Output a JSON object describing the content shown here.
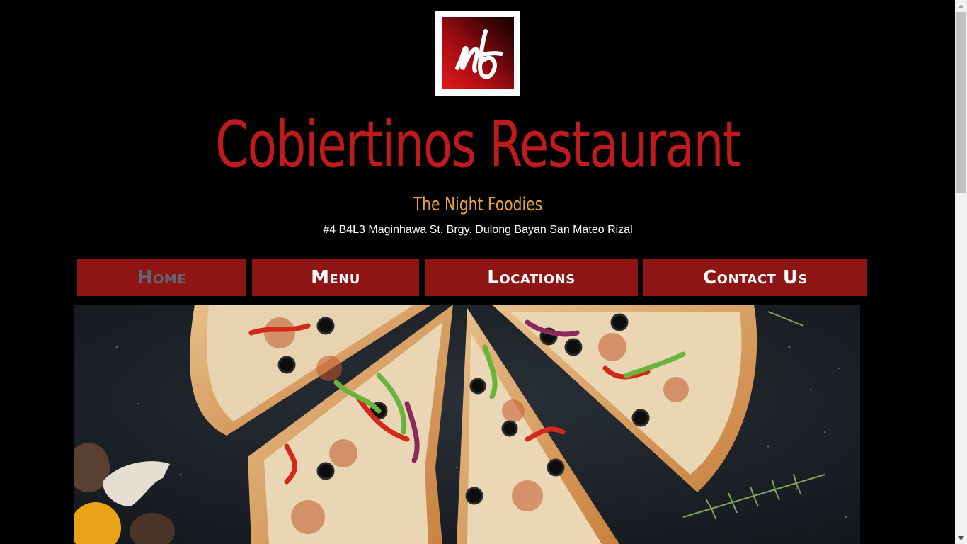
{
  "site": {
    "title": "Cobiertinos Restaurant",
    "tagline": "The Night Foodies",
    "address": "#4 B4L3 Maginhawa St. Brgy. Dulong Bayan San Mateo Rizal",
    "logo_letters": "nf"
  },
  "nav": {
    "items": [
      {
        "label": "Home",
        "active": true
      },
      {
        "label": "Menu",
        "active": false
      },
      {
        "label": "Locations",
        "active": false
      },
      {
        "label": "Contact Us",
        "active": false
      }
    ]
  },
  "hero": {
    "image": "pizza-slices-photo"
  },
  "colors": {
    "background": "#000000",
    "title": "#c01a1c",
    "tagline": "#e8a23a",
    "nav_bg": "#8f1414",
    "nav_active_text": "#5d6873",
    "nav_text": "#ffffff"
  }
}
